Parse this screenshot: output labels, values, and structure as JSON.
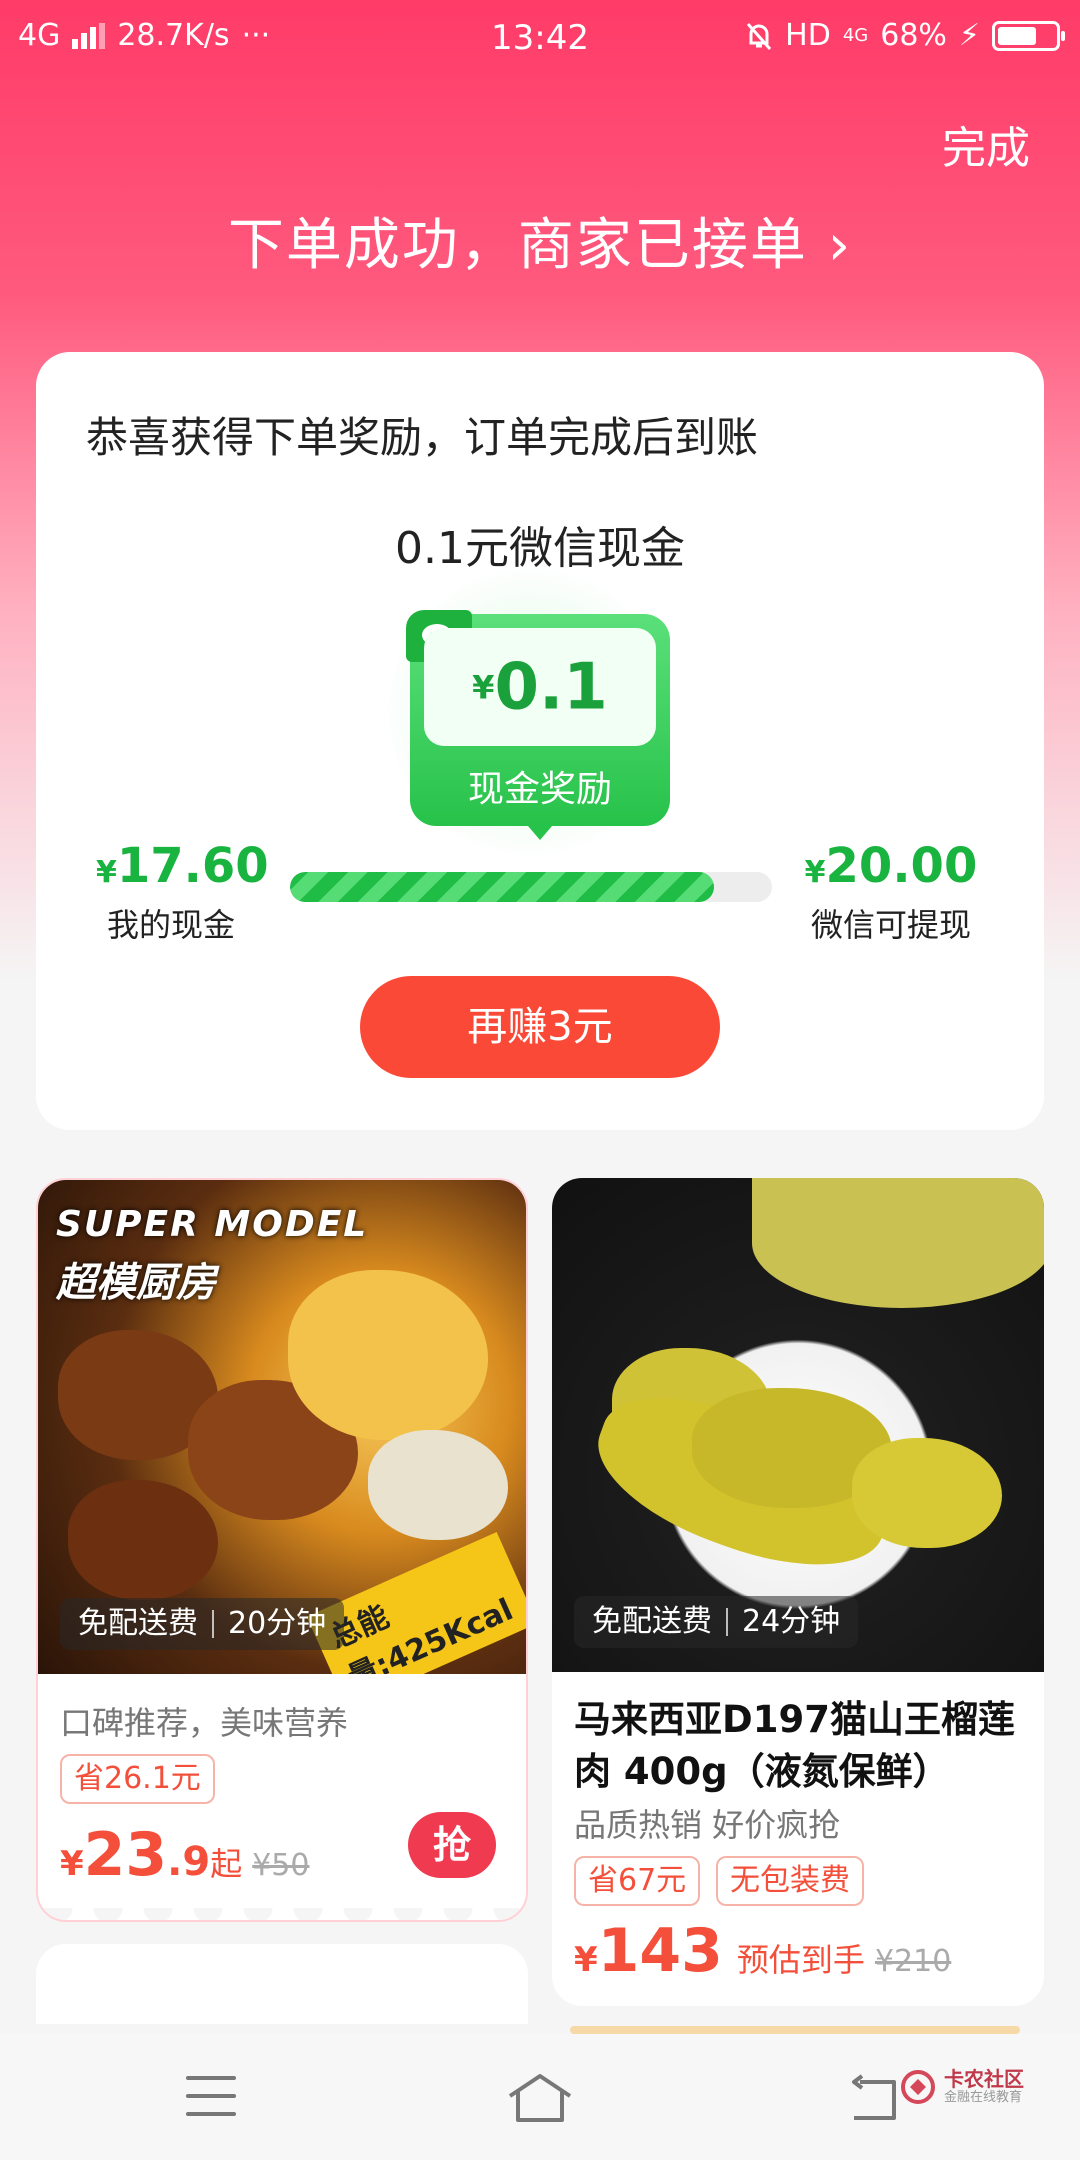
{
  "status_bar": {
    "network": "4G",
    "speed": "28.7K/s",
    "more": "···",
    "time": "13:42",
    "hd": "HD",
    "network_small": "4G",
    "battery": "68%",
    "battery_level": 0.68
  },
  "header": {
    "done_label": "完成",
    "title": "下单成功，商家已接单 ›"
  },
  "reward": {
    "heading": "恭喜获得下单奖励，订单完成后到账",
    "subtitle": "0.1元微信现金",
    "badge_currency": "¥",
    "badge_amount": "0.1",
    "badge_label": "现金奖励",
    "my_cash_currency": "¥",
    "my_cash_value": "17.60",
    "my_cash_label": "我的现金",
    "target_currency": "¥",
    "target_value": "20.00",
    "target_label": "微信可提现",
    "progress": 0.88,
    "earn_button": "再赚3元"
  },
  "products": [
    {
      "image_title": "SUPER MODEL",
      "image_subtitle": "超模厨房",
      "image_badge": "总能量:425Kcal",
      "tag_left": "免配送费",
      "tag_right": "20分钟",
      "desc": "口碑推荐，美味营养",
      "chip1": "省26.1元",
      "currency": "¥",
      "price_int": "23",
      "price_dec": ".9",
      "price_suffix": "起",
      "original_price": "¥50",
      "grab_label": "抢"
    },
    {
      "tag_left": "免配送费",
      "tag_right": "24分钟",
      "title": "马来西亚D197猫山王榴莲肉 400g（液氮保鲜）",
      "desc": "品质热销 好价疯抢",
      "chip1": "省67元",
      "chip2": "无包装费",
      "currency": "¥",
      "price_int": "143",
      "price_suffix": "预估到手",
      "original_price": "¥210"
    }
  ],
  "watermark": {
    "line1": "卡农社区",
    "line2": "金融在线教育"
  },
  "colors": {
    "brand_red": "#ff3b68",
    "cash_green": "#19b43f",
    "button_orange": "#fa4a37",
    "price_red": "#f34f3a"
  }
}
